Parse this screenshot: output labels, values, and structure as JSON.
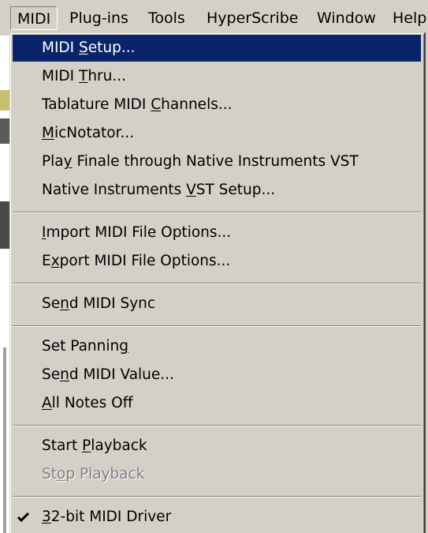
{
  "menubar": {
    "items": [
      {
        "label": "MIDI",
        "active": true
      },
      {
        "label": "Plug-ins"
      },
      {
        "label": "Tools"
      },
      {
        "label": "HyperScribe"
      },
      {
        "label": "Window"
      },
      {
        "label": "Help"
      }
    ]
  },
  "midi_menu": {
    "groups": [
      {
        "items": [
          {
            "label": "MIDI Setup...",
            "mnemonic_index": 5,
            "highlighted": true
          },
          {
            "label": "MIDI Thru...",
            "mnemonic_index": 5
          },
          {
            "label": "Tablature MIDI Channels...",
            "mnemonic_index": 15
          },
          {
            "label": "MicNotator...",
            "mnemonic_index": 0
          },
          {
            "label": "Play Finale through Native Instruments VST",
            "mnemonic_index": 3
          },
          {
            "label": "Native Instruments VST Setup...",
            "mnemonic_index": 19
          }
        ]
      },
      {
        "items": [
          {
            "label": "Import MIDI File Options...",
            "mnemonic_index": 0
          },
          {
            "label": "Export MIDI File Options...",
            "mnemonic_index": 1
          }
        ]
      },
      {
        "items": [
          {
            "label": "Send MIDI Sync",
            "mnemonic_index": 2
          }
        ]
      },
      {
        "items": [
          {
            "label": "Set Panning",
            "mnemonic_index": 10
          },
          {
            "label": "Send MIDI Value...",
            "mnemonic_index": 2
          },
          {
            "label": "All Notes Off",
            "mnemonic_index": 0
          }
        ]
      },
      {
        "items": [
          {
            "label": "Start Playback",
            "mnemonic_index": 6
          },
          {
            "label": "Stop Playback",
            "mnemonic_index": 2,
            "disabled": true
          }
        ]
      },
      {
        "items": [
          {
            "label": "32-bit MIDI Driver",
            "mnemonic_index": 0,
            "checked": true
          }
        ]
      }
    ]
  },
  "colors": {
    "menu_bg": "#d4d0c8",
    "highlight_bg": "#0a246a",
    "highlight_fg": "#ffffff",
    "disabled_fg": "#808080"
  }
}
